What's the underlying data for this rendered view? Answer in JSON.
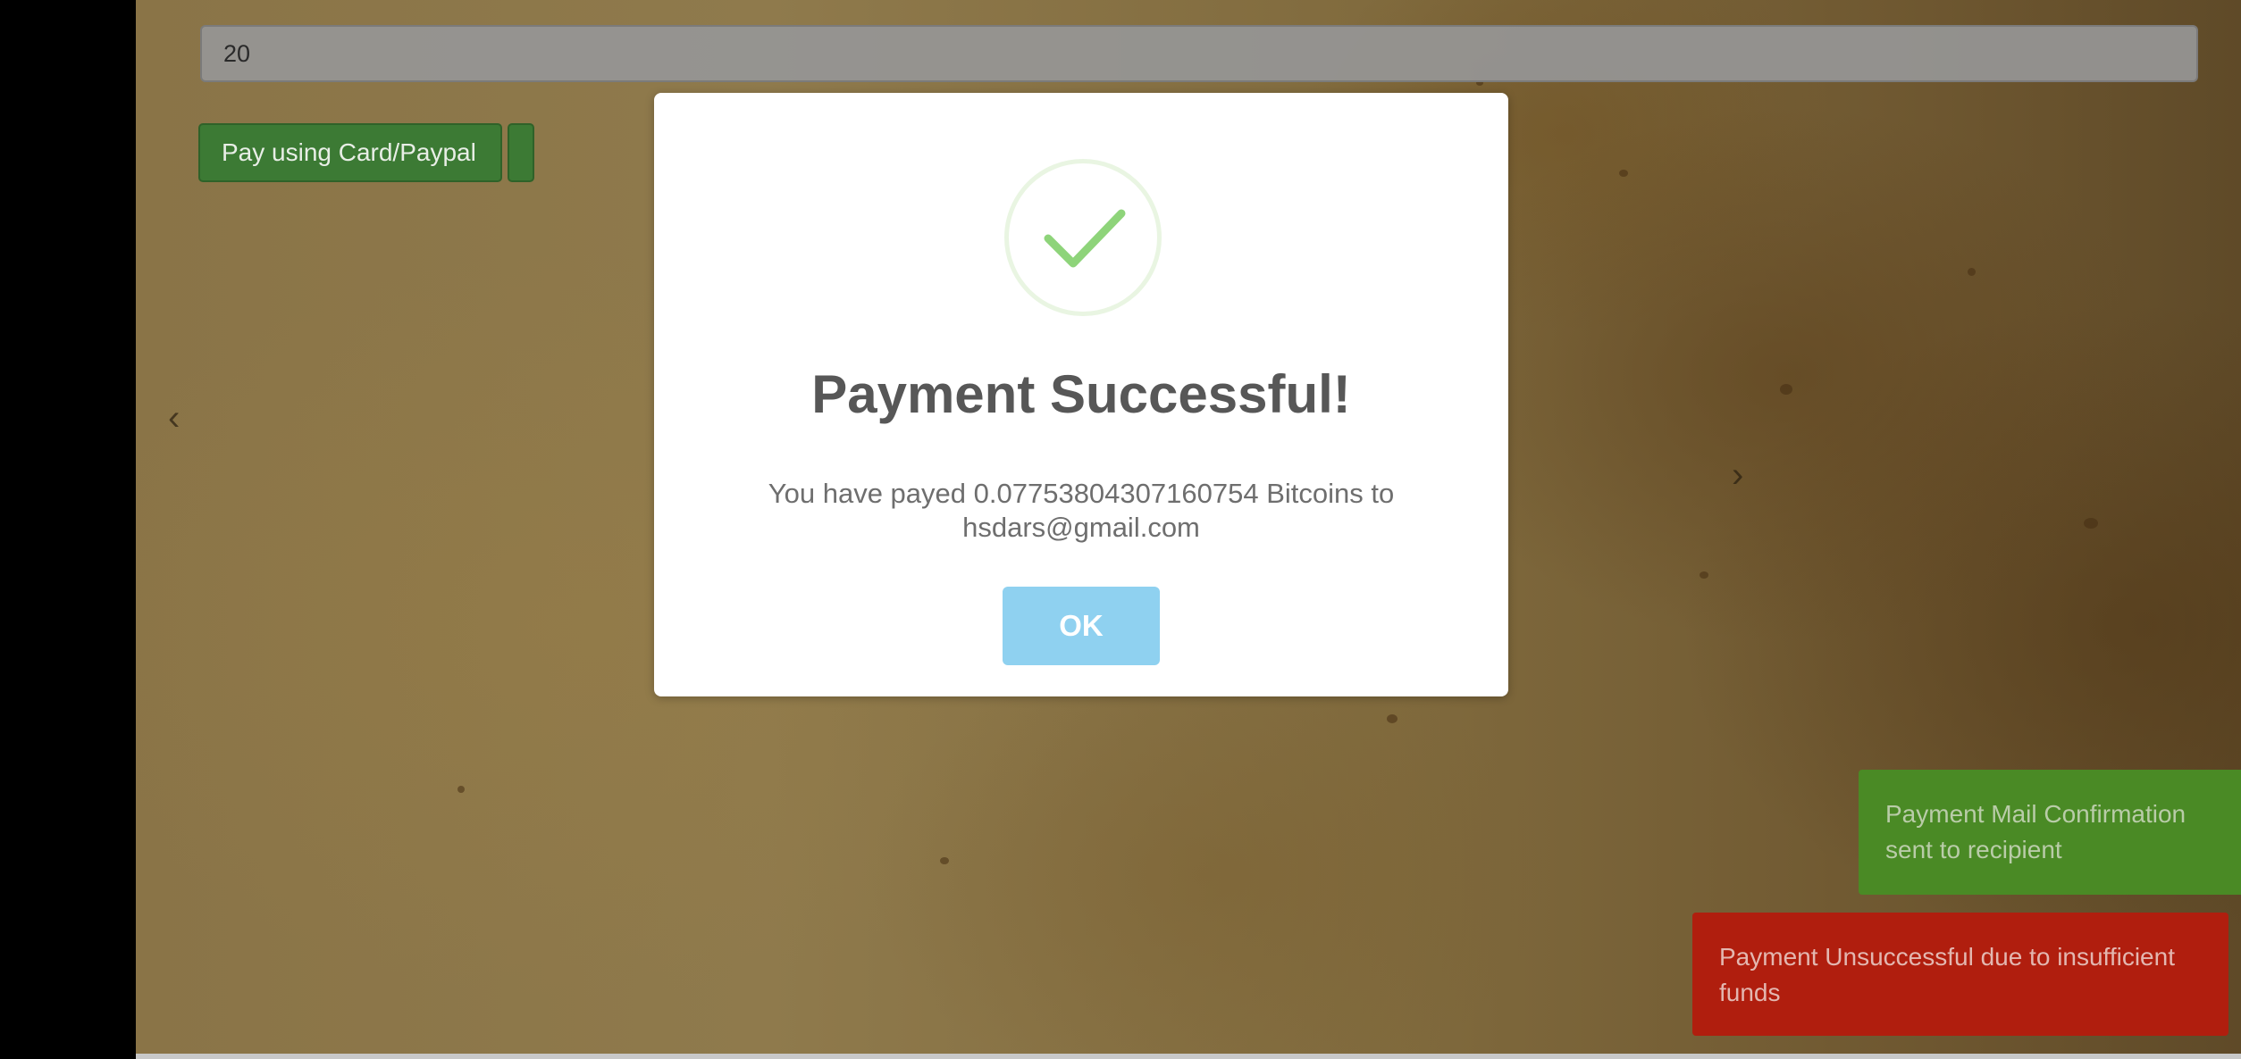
{
  "form": {
    "amount_value": "20",
    "pay_card_label": "Pay using Card/Paypal"
  },
  "carousel": {
    "prev_glyph": "‹",
    "next_glyph": "›"
  },
  "modal": {
    "icon": "checkmark-icon",
    "title": "Payment Successful!",
    "message_line1": "You have payed 0.07753804307160754 Bitcoins to",
    "message_line2": "hsdars@gmail.com",
    "ok_label": "OK",
    "colors": {
      "check": "#8ed47a",
      "ring": "#e9f5e2",
      "ok_button": "#8fd1f0"
    }
  },
  "notifications": [
    {
      "type": "success",
      "text": "Payment Mail Confirmation sent to recipient",
      "color": "#4a8a25"
    },
    {
      "type": "error",
      "text": "Payment Unsuccessful due to insufficient funds",
      "color": "#b01e0e"
    }
  ]
}
